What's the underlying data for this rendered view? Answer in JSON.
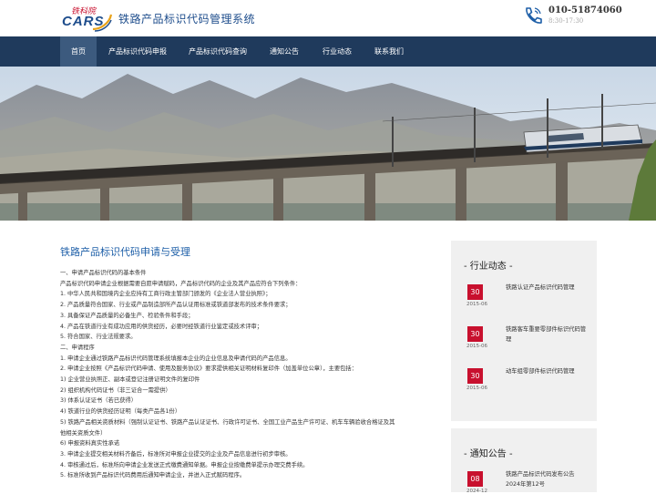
{
  "header": {
    "logo_script": "铁科院",
    "logo_text": "CARS",
    "site_title": "铁路产品标识代码管理系统",
    "phone": "010-51874060",
    "hours": "8:30-17:30"
  },
  "nav": {
    "items": [
      {
        "label": "首页",
        "active": true
      },
      {
        "label": "产品标识代码申报"
      },
      {
        "label": "产品标识代码查询"
      },
      {
        "label": "通知公告"
      },
      {
        "label": "行业动态"
      },
      {
        "label": "联系我们"
      }
    ]
  },
  "main": {
    "title": "铁路产品标识代码申请与受理",
    "lines": [
      "一、申请产品标识代码的基本条件",
      "产品标识代码申请企业根据需要自愿申请赋码，产品标识代码的企业及其产品应符合下列条件：",
      "1. 中华人民共和国境内企业应持有工商行政主管部门颁发的《企业法人营业执照》；",
      "2. 产品质量符合国家、行业或产品制造部所产品认证用标准或铁道部发布的技术条件要求；",
      "3. 具备保证产品质量的必备生产、检验条件和手段；",
      "4. 产品在铁道行业有成功应用的供货经历，必要时经铁道行业鉴定或技术评审；",
      "5. 符合国家、行业法规要求。",
      "二、申请程序",
      "1. 申请企业通过铁路产品标识代码管理系统填报本企业的企业信息及申请代码的产品信息。",
      "2. 申请企业按照《产品标识代码申请、使用及服务协议》要求提供相关证明材料复印件（加盖单位公章），主要包括：",
      "1) 企业营业执照正、副本或登记注册证明文件的复印件",
      "2) 组织机构代码证书（非三证合一需提供）",
      "3) 体系认证证书（若已获得）",
      "4) 铁道行业的供货经历证明（每类产品各1份）",
      "5) 铁路产品相关资质材料（强制认证证书、铁路产品认证证书、行政许可证书、全国工业产品生产许可证、机车车辆验收合格证及其",
      "他相关资质文件）",
      "6) 申报资料真实性承诺",
      "3. 申请企业提交相关材料齐备后，标准所对申报企业提交的企业及产品信息进行初步审核。",
      "4. 审核通过后，标准所向申请企业发送正式缴费通知单据。申报企业按缴费单提示办理交费手续。",
      "5. 标准所收到产品标识代码费用后通知申请企业，并进入正式赋码程序。"
    ]
  },
  "industry_news": {
    "heading": "- 行业动态 -",
    "items": [
      {
        "day": "30",
        "ym": "2015-06",
        "text": "铁路认证产品标识代码管理"
      },
      {
        "day": "30",
        "ym": "2015-06",
        "text": "铁路客车重要零部件标识代码管理"
      },
      {
        "day": "30",
        "ym": "2015-06",
        "text": "动车组零部件标识代码管理"
      }
    ]
  },
  "notices": {
    "heading": "- 通知公告 -",
    "items": [
      {
        "day": "08",
        "ym": "2024-12",
        "text": "铁路产品标识代码发布公告 2024年第12号"
      }
    ]
  },
  "colors": {
    "nav_bg": "#1f3a5c",
    "nav_active": "#3c5a7e",
    "accent_blue": "#1e5fa8",
    "badge_red": "#c8102e"
  }
}
